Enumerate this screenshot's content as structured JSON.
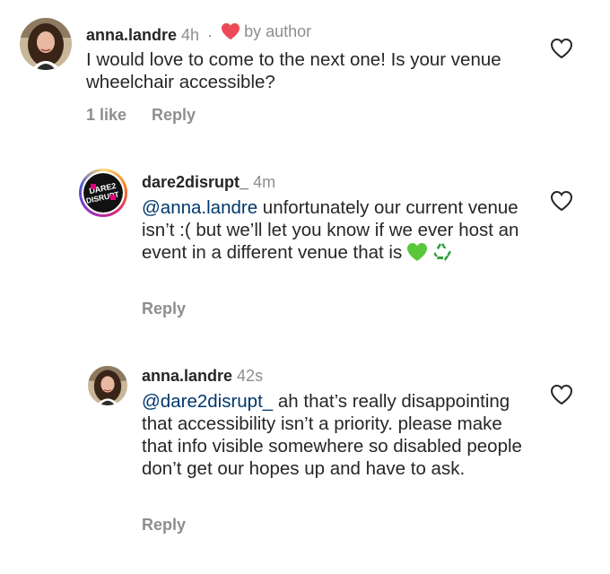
{
  "comments": [
    {
      "username": "anna.landre",
      "time": "4h",
      "separator": "·",
      "badge": "by author",
      "text": "I would love to come to the next one! Is your venue wheelchair accessible?",
      "likes": "1 like",
      "reply": "Reply"
    },
    {
      "username": "dare2disrupt_",
      "time": "4m",
      "mention": "@anna.landre",
      "text": " unfortunately our current venue isn’t :( but we’ll let you know if we ever host an event in a different venue that is",
      "emojis": [
        "green-heart",
        "recycling-symbol"
      ],
      "reply": "Reply"
    },
    {
      "username": "anna.landre",
      "time": "42s",
      "mention": "@dare2disrupt_",
      "text": " ah that’s really disappointing that accessibility isn’t a priority. please make that info visible somewhere so disabled people don’t get our hopes up and have to ask.",
      "reply": "Reply"
    }
  ],
  "colors": {
    "heart_red": "#ed4956",
    "mention_blue": "#00376b",
    "secondary_gray": "#8e8e8e"
  }
}
